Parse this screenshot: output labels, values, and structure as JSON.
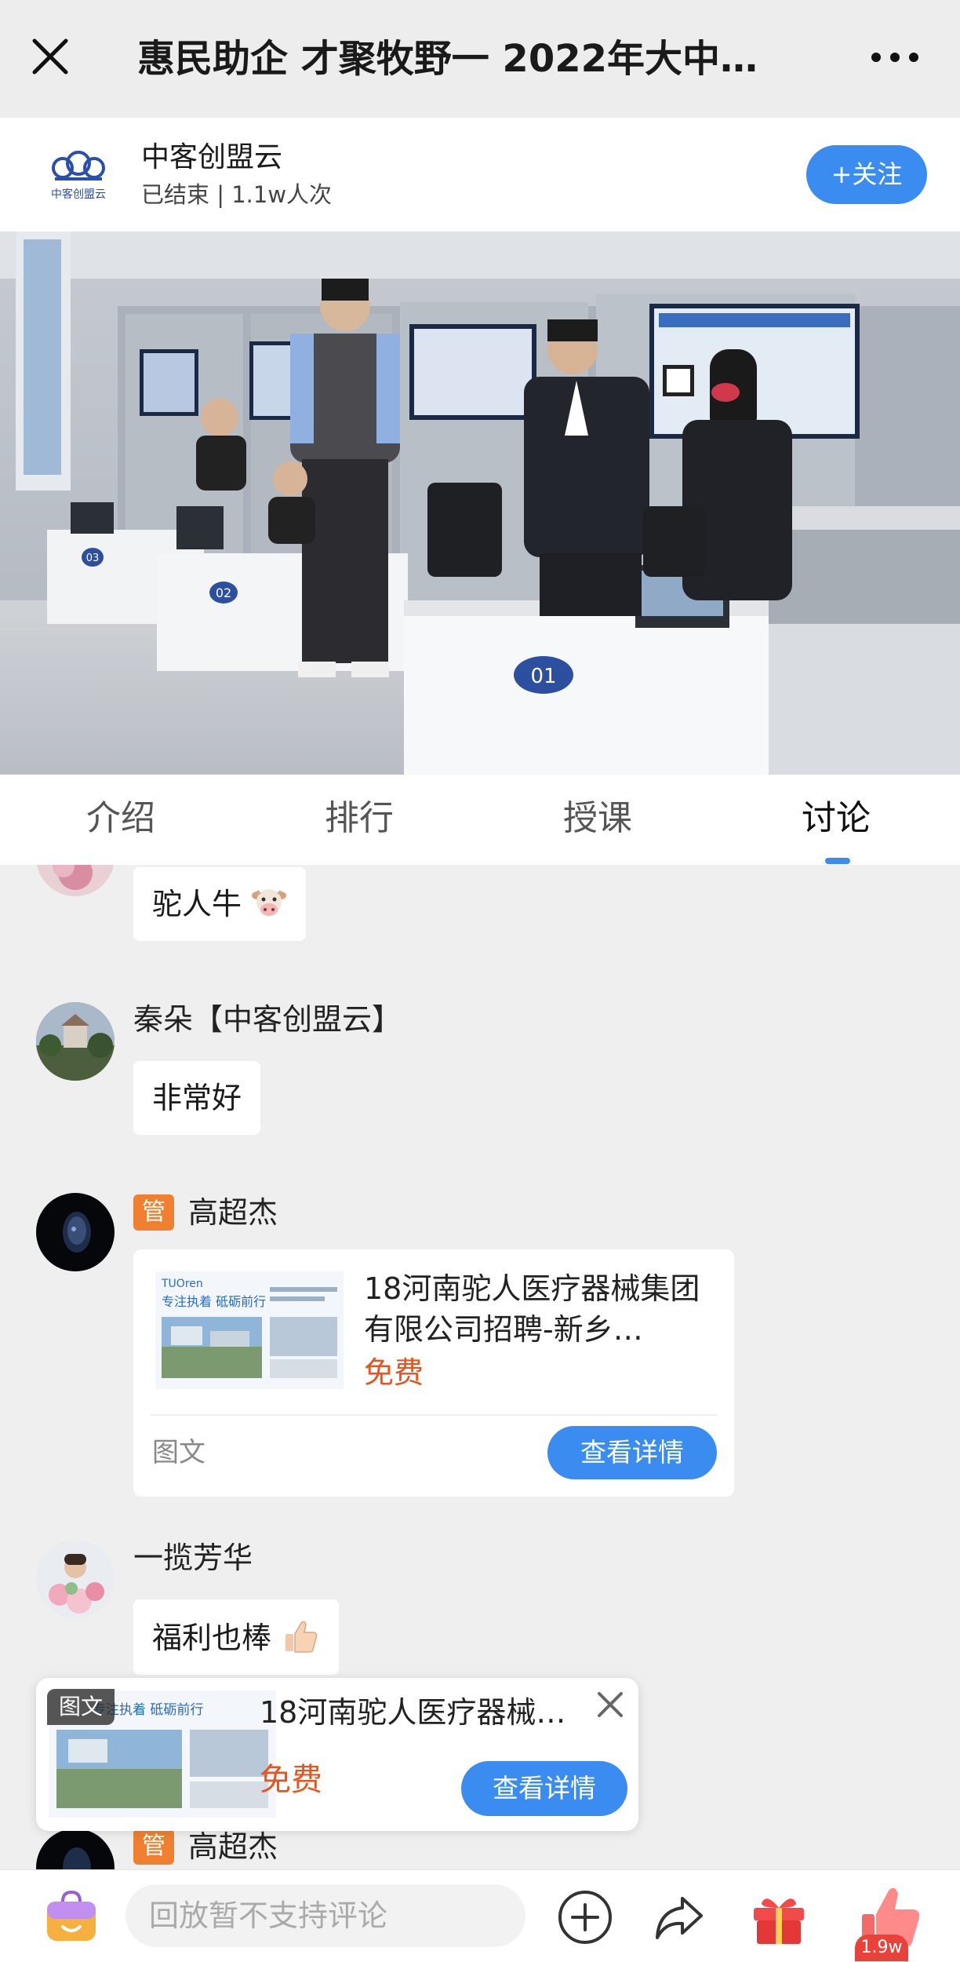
{
  "topbar": {
    "title": "惠民助企 才聚牧野一 2022年大中…",
    "close_icon": "close-icon",
    "more_icon": "more-icon"
  },
  "channel": {
    "name": "中客创盟云",
    "logo_text": "中客创盟云",
    "status": "已结束 | 1.1w人次",
    "follow_label": "+关注",
    "accent": "#3b8cf0"
  },
  "video": {
    "desk_numbers": [
      "01",
      "02",
      "03"
    ]
  },
  "tabs": [
    {
      "label": "介绍",
      "active": false
    },
    {
      "label": "排行",
      "active": false
    },
    {
      "label": "授课",
      "active": false
    },
    {
      "label": "讨论",
      "active": true
    }
  ],
  "messages": [
    {
      "user": "",
      "text": "驼人牛",
      "emoji": "cow-face-icon"
    },
    {
      "user": "秦朵【中客创盟云】",
      "text": "非常好"
    },
    {
      "user": "高超杰",
      "admin_tag": "管",
      "card": {
        "title": "18河南驼人医疗器械集团有限公司招聘-新乡…",
        "price": "免费",
        "type": "图文",
        "detail_label": "查看详情",
        "thumb_brand": "TUOren",
        "thumb_slogan": "专注执着 砥砺前行"
      }
    },
    {
      "user": "一揽芳华",
      "text": "福利也棒",
      "emoji": "thumbs-up-icon"
    },
    {
      "user": "高超杰",
      "admin_tag": "管"
    }
  ],
  "float_card": {
    "tag": "图文",
    "title": "18河南驼人医疗器械…",
    "price": "免费",
    "detail_label": "查看详情",
    "thumb_slogan": "专注执着 砥砺前行"
  },
  "bottombar": {
    "placeholder": "回放暂不支持评论",
    "like_count": "1.9w"
  },
  "colors": {
    "primary": "#3b8cf0",
    "price": "#e8541e",
    "admin": "#f08030",
    "like": "#e8423a"
  }
}
